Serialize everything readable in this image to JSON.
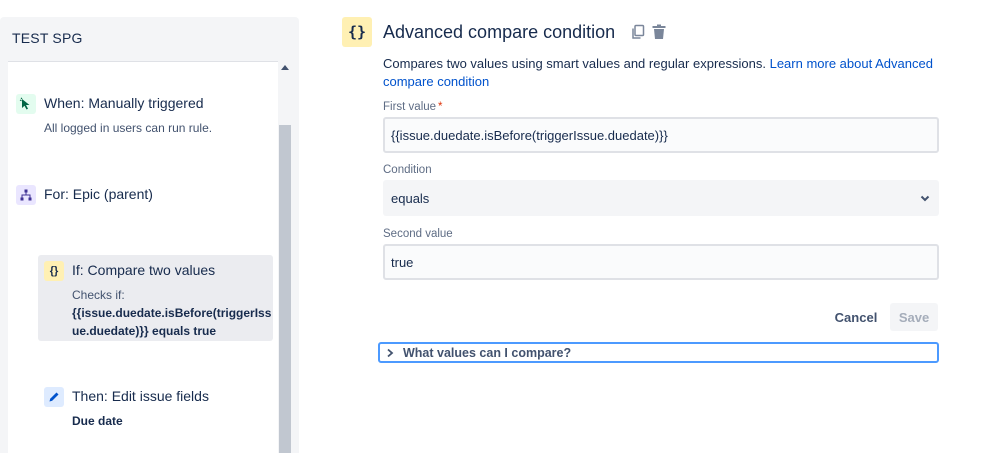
{
  "sidebar": {
    "title": "TEST SPG",
    "steps": [
      {
        "type": "trigger",
        "icon": "cursor-click-icon",
        "title": "When: Manually triggered",
        "description": "All logged in users can run rule."
      },
      {
        "type": "branch",
        "icon": "hierarchy-icon",
        "title": "For: Epic (parent)"
      },
      {
        "type": "condition",
        "icon": "curly-braces-icon",
        "icon_glyph": "{}",
        "title": "If: Compare two values",
        "description_prefix": "Checks if:",
        "description_bold": "{{issue.duedate.isBefore(triggerIssue.duedate)}} equals true"
      },
      {
        "type": "action",
        "icon": "pencil-icon",
        "title": "Then: Edit issue fields",
        "description": "Due date"
      }
    ]
  },
  "config": {
    "icon_glyph": "{}",
    "title": "Advanced compare condition",
    "description": "Compares two values using smart values and regular expressions.",
    "learn_more_link": "Learn more about Advanced compare condition",
    "first_value_label": "First value",
    "first_value": "{{issue.duedate.isBefore(triggerIssue.duedate)}}",
    "condition_label": "Condition",
    "condition_value": "equals",
    "second_value_label": "Second value",
    "second_value": "true",
    "cancel_label": "Cancel",
    "save_label": "Save",
    "expander_label": "What values can I compare?"
  },
  "colors": {
    "link": "#0052cc",
    "trigger_icon_bg": "#e3fcef",
    "branch_icon_bg": "#eae6ff",
    "condition_icon_bg": "#fff0b3",
    "action_icon_bg": "#deebff",
    "focus_border": "#4c9aff",
    "required": "#de350b"
  }
}
